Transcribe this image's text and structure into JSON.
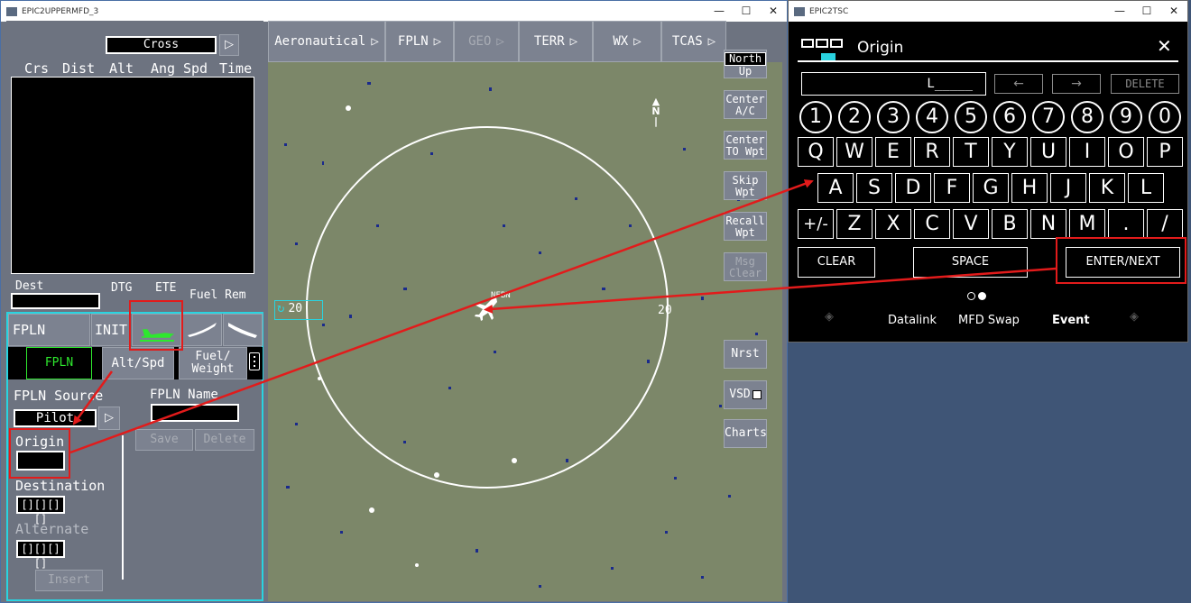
{
  "window_main": {
    "title": "EPIC2UPPERMFD_3",
    "controls": [
      "—",
      "☐",
      "✕"
    ]
  },
  "window_tsc": {
    "title": "EPIC2TSC",
    "controls": [
      "—",
      "☐",
      "✕"
    ]
  },
  "left": {
    "mode_value": "Cross",
    "mode_arrow": "▷",
    "columns": [
      "Crs",
      "Dist",
      "Alt",
      "Ang",
      "Spd",
      "Time"
    ],
    "dest_label": "Dest",
    "dtg_label": "DTG",
    "ete_label": "ETE",
    "fuel_rem_label": "Fuel Rem",
    "tabs": {
      "fpln": "FPLN",
      "init": "INIT"
    },
    "subtabs": {
      "fpln": "FPLN",
      "alt_spd": "Alt/Spd",
      "fuel_weight_1": "Fuel/",
      "fuel_weight_2": "Weight"
    },
    "fpln_source_label": "FPLN Source",
    "fpln_source_value": "Pilot",
    "fpln_name_label": "FPLN Name",
    "save_label": "Save",
    "delete_label": "Delete",
    "origin_label": "Origin",
    "destination_label": "Destination",
    "destination_value": "[][][][]",
    "alternate_label": "Alternate",
    "alternate_value": "[][][][]",
    "insert_label": "Insert"
  },
  "topmenu": [
    {
      "label": "Aeronautical",
      "arrow": "▷"
    },
    {
      "label": "FPLN",
      "arrow": "▷"
    },
    {
      "label": "GEO",
      "arrow": "▷"
    },
    {
      "label": "TERR",
      "arrow": "▷"
    },
    {
      "label": "WX",
      "arrow": "▷"
    },
    {
      "label": "TCAS",
      "arrow": "▷"
    }
  ],
  "sidebuttons": {
    "north_up_1": "North",
    "north_up_2": "Up",
    "center_ac_1": "Center",
    "center_ac_2": "A/C",
    "center_to_1": "Center",
    "center_to_2": "TO Wpt",
    "skip_1": "Skip",
    "skip_2": "Wpt",
    "recall_1": "Recall",
    "recall_2": "Wpt",
    "msg_1": "Msg",
    "msg_2": "Clear",
    "nrst": "Nrst",
    "vsd": "VSD",
    "charts": "Charts"
  },
  "map": {
    "range_label": "20",
    "ring_left_label": "20",
    "ring_right_label": "20",
    "north_label": "N",
    "aircraft_label": "NFBN"
  },
  "tsc": {
    "title": "Origin",
    "input_value": "L_____",
    "left_arrow": "←",
    "right_arrow": "→",
    "delete_label": "DELETE",
    "numbers": [
      "1",
      "2",
      "3",
      "4",
      "5",
      "6",
      "7",
      "8",
      "9",
      "0"
    ],
    "row_q": [
      "Q",
      "W",
      "E",
      "R",
      "T",
      "Y",
      "U",
      "I",
      "O",
      "P"
    ],
    "row_a": [
      "A",
      "S",
      "D",
      "F",
      "G",
      "H",
      "J",
      "K",
      "L"
    ],
    "row_z": [
      "+/-",
      "Z",
      "X",
      "C",
      "V",
      "B",
      "N",
      "M",
      ".",
      "/"
    ],
    "clear_label": "CLEAR",
    "space_label": "SPACE",
    "enter_label": "ENTER/NEXT",
    "bottom": {
      "datalink": "Datalink",
      "mfd_swap": "MFD Swap",
      "event": "Event"
    },
    "close_icon": "✕"
  },
  "colors": {
    "map_bg": "#7c8769",
    "panel_bg": "#6d7380",
    "cyan": "#29d3e0",
    "green": "#2ee82e",
    "annotation_red": "#e21b1b"
  }
}
